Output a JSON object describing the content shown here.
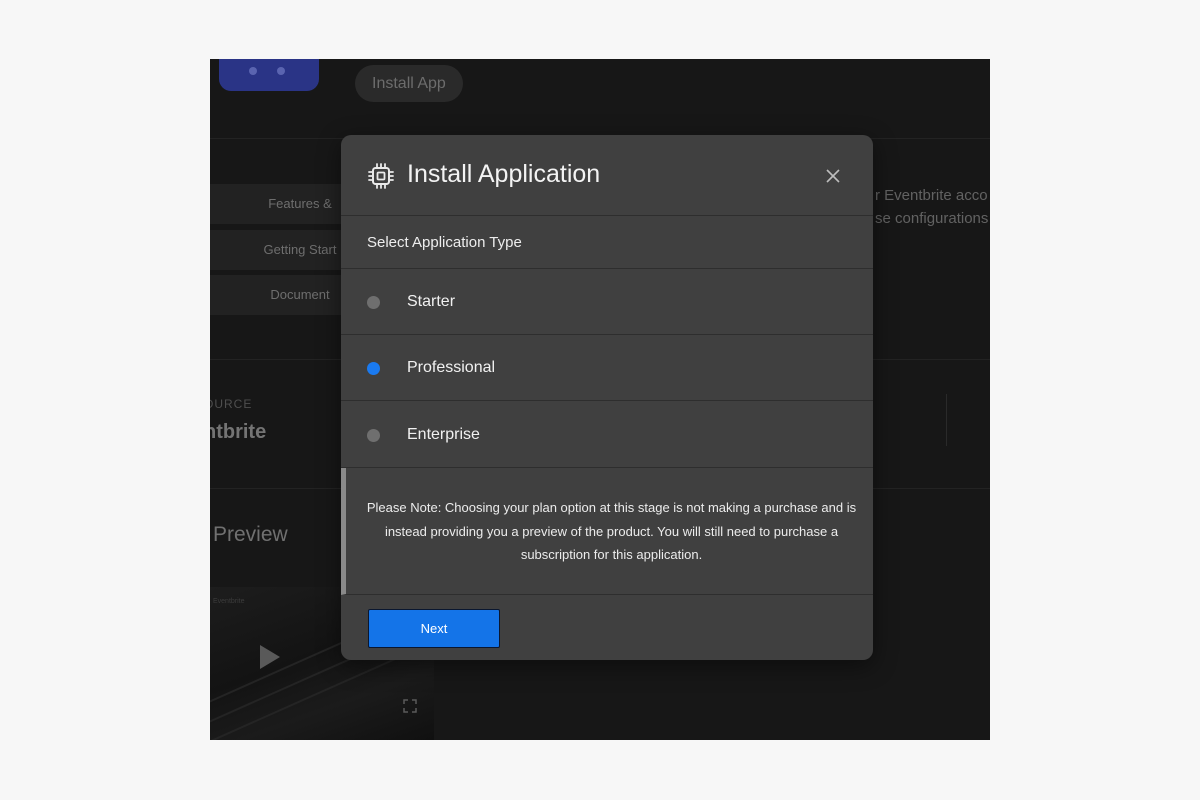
{
  "background": {
    "install_app_label": "Install App",
    "nav_items": [
      "Features &",
      "Getting Start",
      "Document"
    ],
    "description_lines": [
      "r Eventbrite acco",
      "se configurations"
    ],
    "source_label": "OURCE",
    "source_value": "ntbrite",
    "preview_title": "Preview",
    "video_caption": "Eventbrite"
  },
  "modal": {
    "title": "Install Application",
    "icon": "chip-icon",
    "section_title": "Select Application Type",
    "options": [
      {
        "label": "Starter",
        "selected": false
      },
      {
        "label": "Professional",
        "selected": true
      },
      {
        "label": "Enterprise",
        "selected": false
      }
    ],
    "note": "Please Note: Choosing your plan option at this stage is not making a purchase and is instead providing you a preview of the product. You will still need to purchase a subscription for this application.",
    "next_label": "Next"
  },
  "colors": {
    "accent": "#1a7af0",
    "modal_bg": "#404040",
    "overlay_bg": "#171717"
  }
}
